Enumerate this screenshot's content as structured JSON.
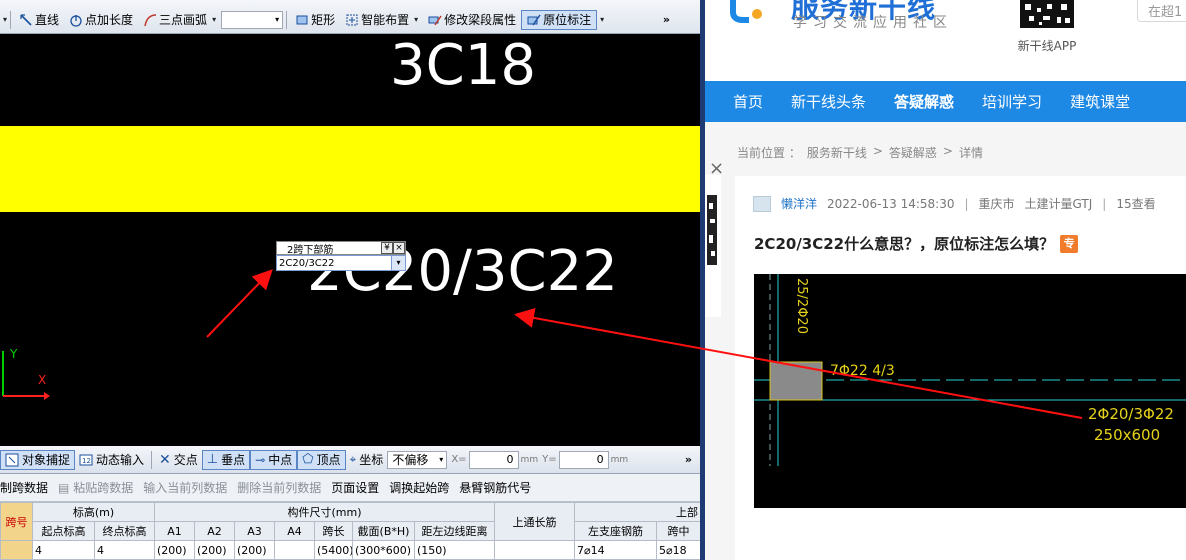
{
  "cad": {
    "toolbar": {
      "line": "直线",
      "point_length": "点加长度",
      "three_point_arc": "三点画弧",
      "rectangle": "矩形",
      "smart_layout": "智能布置",
      "modify_span_props": "修改梁段属性",
      "in_place_annotation": "原位标注",
      "more": "»"
    },
    "canvas": {
      "top_label": "3C18",
      "bottom_label": "2C20/3C22",
      "beam_color": "#ffff00",
      "popup": {
        "title": "2跨下部筋",
        "value": "2C20/3C22"
      },
      "axis_y": "Y",
      "axis_x": "X"
    },
    "snap_toolbar": {
      "object_snap": "对象捕捉",
      "dynamic_input": "动态输入",
      "intersection": "交点",
      "perpendicular": "垂点",
      "midpoint": "中点",
      "vertex": "顶点",
      "coordinate": "坐标",
      "offset_mode": "不偏移",
      "x_label": "X=",
      "x_value": "0",
      "y_label": "Y=",
      "y_value": "0",
      "unit": "mm",
      "more": "»"
    },
    "ops_toolbar": {
      "copy_span_data": "制跨数据",
      "paste_span_data": "粘贴跨数据",
      "input_current_column": "输入当前列数据",
      "delete_current_column": "删除当前列数据",
      "page_setup": "页面设置",
      "swap_start_span": "调换起始跨",
      "cantilever_code": "悬臂钢筋代号"
    },
    "grid": {
      "group_headers": {
        "span_no": "跨号",
        "elevation": "标高(m)",
        "dimensions": "构件尺寸(mm)",
        "top_through": "上通长筋",
        "top_section": "上部"
      },
      "headers": {
        "start_elev": "起点标高",
        "end_elev": "终点标高",
        "a1": "A1",
        "a2": "A2",
        "a3": "A3",
        "a4": "A4",
        "span_len": "跨长",
        "section": "截面(B*H)",
        "edge_dist": "距左边线距离",
        "left_support": "左支座钢筋",
        "span_mid": "跨中"
      },
      "row": {
        "start_elev": "4",
        "end_elev": "4",
        "a1": "(200)",
        "a2": "(200)",
        "a3": "(200)",
        "a4": "",
        "span_len": "(5400)",
        "section": "(300*600)",
        "edge_dist": "(150)",
        "top_through": "",
        "left_support": "7⌀14",
        "span_mid": "5⌀18"
      }
    }
  },
  "web": {
    "logo": {
      "name": "服务新干线",
      "slogan": "学习交流应用社区"
    },
    "qr_caption": "新干线APP",
    "search_placeholder": "在超1",
    "nav": [
      "首页",
      "新干线头条",
      "答疑解惑",
      "培训学习",
      "建筑课堂"
    ],
    "breadcrumb": {
      "label": "当前位置 ：",
      "items": [
        "服务新干线",
        "答疑解惑",
        "详情"
      ],
      "separator": ">"
    },
    "close": "×",
    "post": {
      "user": "懒洋洋",
      "datetime": "2022-06-13 14:58:30",
      "city": "重庆市",
      "category": "土建计量GTJ",
      "views": "15查看",
      "title": "2C20/3C22什么意思？，原位标注怎么填？",
      "tag": "专"
    },
    "figure": {
      "vertical_text": "25/2Φ20",
      "stirrup_text": "7Φ22 4/3",
      "rebar_text": "2Φ20/3Φ22",
      "section_text": "250x600"
    }
  }
}
